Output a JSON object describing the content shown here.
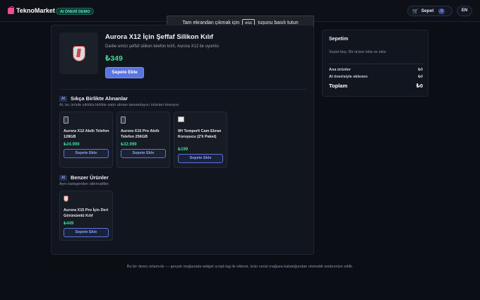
{
  "header": {
    "brand": "TeknoMarket",
    "ai_badge": "AI ÖNERİ DEMO",
    "cart_label": "Sepet",
    "cart_count": "0",
    "lang": "EN"
  },
  "fullscreen_toast": {
    "before": "Tam ekrandan çıkmak için",
    "key": "esc",
    "after": "tuşunu basılı tutun"
  },
  "product": {
    "title": "Aurora X12 İçin Şeffaf Silikon Kılıf",
    "description": "Darbe emici şeffaf silikon telefon kılıfı, Aurora X12 ile uyumlu",
    "price": "₺349",
    "add_label": "Sepete Ekle"
  },
  "frequently_bought": {
    "tag": "AI",
    "title": "Sıkça Birlikte Alınanlar",
    "subtitle": "AI, bu ürünle sıklıkla birlikte satın alınan tamamlayıcı ürünleri öneriyor.",
    "items": [
      {
        "name": "Aurora X12 Akıllı Telefon 128GB",
        "price": "₺24.999",
        "button": "Sepete Ekle",
        "icon": "phone-icon"
      },
      {
        "name": "Aurora X15 Pro Akıllı Telefon 256GB",
        "price": "₺32.999",
        "button": "Sepete Ekle",
        "icon": "phone-icon"
      },
      {
        "name": "9H Temperli Cam Ekran Koruyucu (2'li Paket)",
        "price": "₺199",
        "button": "Sepete Ekle",
        "icon": "screen-protector-icon"
      }
    ]
  },
  "similar": {
    "tag": "AI",
    "title": "Benzer Ürünler",
    "subtitle": "Aynı kategoriden alternatifler.",
    "items": [
      {
        "name": "Aurora X15 Pro İçin Deri Görünümlü Kılıf",
        "price": "₺449",
        "button": "Sepete Ekle",
        "icon": "phone-case-icon"
      }
    ]
  },
  "cart": {
    "title": "Sepetim",
    "empty_text": "Sepet boş. Bir ürüne tıkla ve ekle.",
    "subtotal_label": "Ana ürünler",
    "subtotal_value": "₺0",
    "ai_label": "AI önerisiyle eklenen",
    "ai_value": "₺0",
    "total_label": "Toplam",
    "total_value": "₺0"
  },
  "footer": "Bu bir demo ortamıdır — gerçek mağazada widget script-tag ile eklenir, ürün verisi mağaza kataloğundan otomatik senkronize edilir.",
  "colors": {
    "accent": "#5b74e0",
    "price": "#3ddc97",
    "brand": "#ef4f8b",
    "background": "#0b0e14"
  }
}
